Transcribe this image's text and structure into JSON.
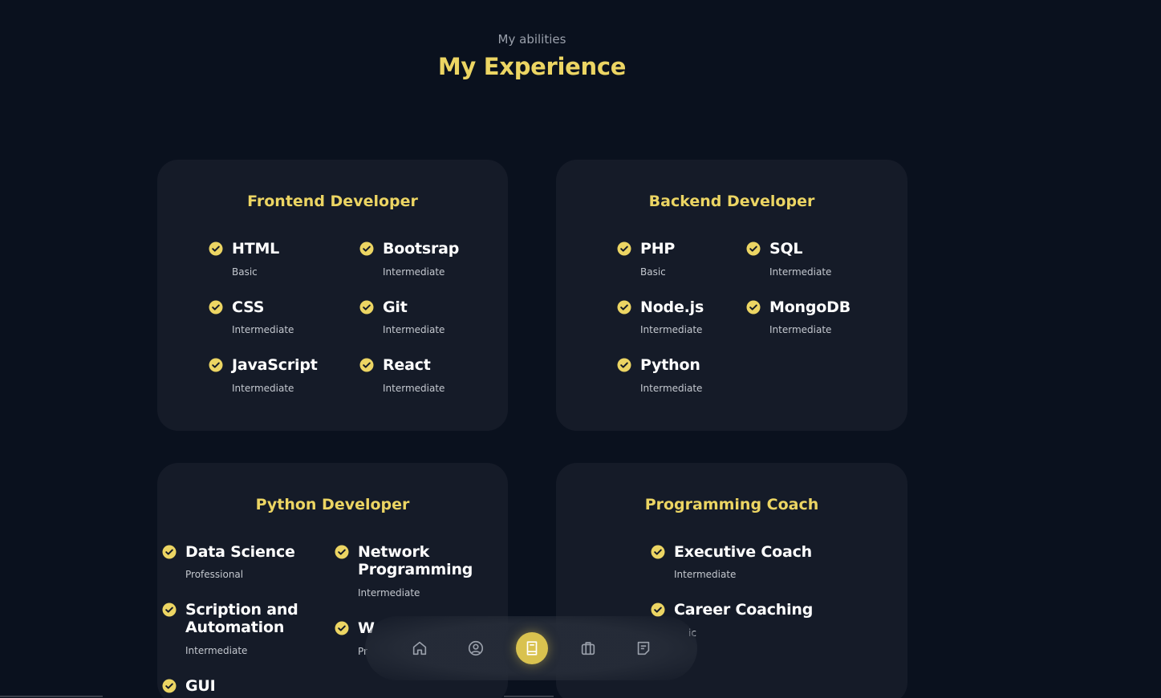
{
  "header": {
    "subtitle": "My abilities",
    "title": "My Experience"
  },
  "colors": {
    "background": "#0a111e",
    "card": "#151b28",
    "accent": "#ecd563"
  },
  "cards": [
    {
      "title": "Frontend Developer",
      "skills": [
        {
          "name": "HTML",
          "level": "Basic"
        },
        {
          "name": "Bootsrap",
          "level": "Intermediate"
        },
        {
          "name": "CSS",
          "level": "Intermediate"
        },
        {
          "name": "Git",
          "level": "Intermediate"
        },
        {
          "name": "JavaScript",
          "level": "Intermediate"
        },
        {
          "name": "React",
          "level": "Intermediate"
        }
      ]
    },
    {
      "title": "Backend Developer",
      "skills": [
        {
          "name": "PHP",
          "level": "Basic"
        },
        {
          "name": "SQL",
          "level": "Intermediate"
        },
        {
          "name": "Node.js",
          "level": "Intermediate"
        },
        {
          "name": "MongoDB",
          "level": "Intermediate"
        },
        {
          "name": "Python",
          "level": "Intermediate"
        }
      ]
    },
    {
      "title": "Python Developer",
      "skills": [
        {
          "name": "Data Science",
          "level": "Professional"
        },
        {
          "name": "Network Programming",
          "level": "Intermediate"
        },
        {
          "name": "Scription and Automation",
          "level": "Intermediate"
        },
        {
          "name": "W",
          "level": "Pr"
        },
        {
          "name": "GUI",
          "level": ""
        }
      ]
    },
    {
      "title": "Programming Coach",
      "skills": [
        {
          "name": "Executive Coach",
          "level": "Intermediate"
        },
        {
          "name": "Career Coaching",
          "level": "ic"
        }
      ]
    }
  ],
  "nav": {
    "items": [
      {
        "icon": "home-icon",
        "active": false
      },
      {
        "icon": "user-circle-icon",
        "active": false
      },
      {
        "icon": "book-icon",
        "active": true
      },
      {
        "icon": "briefcase-icon",
        "active": false
      },
      {
        "icon": "message-icon",
        "active": false
      }
    ]
  }
}
